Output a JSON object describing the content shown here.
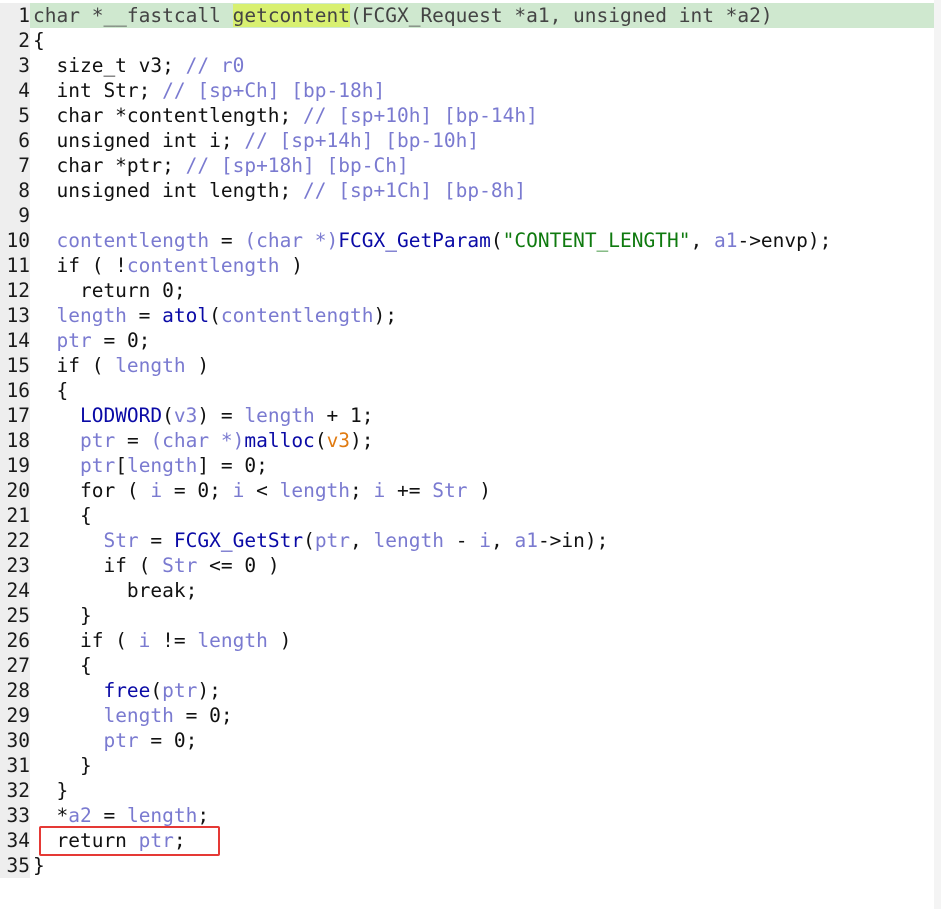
{
  "window": {
    "type": "pseudocode-view",
    "colors": {
      "highlight_line": "#cfe8cf",
      "function_name_highlight": "#d8f070",
      "keyword": "#111111",
      "function_call": "#0a0aa6",
      "variable": "#7a7ad0",
      "string": "#0f7a0f",
      "annotation_box": "#e53935",
      "gutter": "#eeeeee"
    }
  },
  "code": {
    "lines": [
      {
        "n": "1",
        "hl": true,
        "tokens": [
          [
            "sig",
            "char *__fastcall "
          ],
          [
            "hi",
            "getcontent"
          ],
          [
            "sig",
            "(FCGX_Request *a1, unsigned int *a2)"
          ]
        ]
      },
      {
        "n": "2",
        "tokens": [
          [
            "pl",
            "{"
          ]
        ]
      },
      {
        "n": "3",
        "tokens": [
          [
            "pl",
            "  size_t v3; "
          ],
          [
            "cmt",
            "// r0"
          ]
        ]
      },
      {
        "n": "4",
        "tokens": [
          [
            "pl",
            "  int Str; "
          ],
          [
            "cmt",
            "// [sp+Ch] [bp-18h]"
          ]
        ]
      },
      {
        "n": "5",
        "tokens": [
          [
            "pl",
            "  char *contentlength; "
          ],
          [
            "cmt",
            "// [sp+10h] [bp-14h]"
          ]
        ]
      },
      {
        "n": "6",
        "tokens": [
          [
            "pl",
            "  unsigned int i; "
          ],
          [
            "cmt",
            "// [sp+14h] [bp-10h]"
          ]
        ]
      },
      {
        "n": "7",
        "tokens": [
          [
            "pl",
            "  char *ptr; "
          ],
          [
            "cmt",
            "// [sp+18h] [bp-Ch]"
          ]
        ]
      },
      {
        "n": "8",
        "tokens": [
          [
            "pl",
            "  unsigned int length; "
          ],
          [
            "cmt",
            "// [sp+1Ch] [bp-8h]"
          ]
        ]
      },
      {
        "n": "9",
        "tokens": []
      },
      {
        "n": "10",
        "tokens": [
          [
            "pl",
            "  "
          ],
          [
            "var",
            "contentlength"
          ],
          [
            "pl",
            " = "
          ],
          [
            "var",
            "(char *)"
          ],
          [
            "fn",
            "FCGX_GetParam"
          ],
          [
            "pl",
            "("
          ],
          [
            "str",
            "\"CONTENT_LENGTH\""
          ],
          [
            "pl",
            ", "
          ],
          [
            "var",
            "a1"
          ],
          [
            "pl",
            "->envp);"
          ]
        ]
      },
      {
        "n": "11",
        "tokens": [
          [
            "pl",
            "  if ( !"
          ],
          [
            "var",
            "contentlength"
          ],
          [
            "pl",
            " )"
          ]
        ]
      },
      {
        "n": "12",
        "tokens": [
          [
            "pl",
            "    return 0;"
          ]
        ]
      },
      {
        "n": "13",
        "tokens": [
          [
            "pl",
            "  "
          ],
          [
            "var",
            "length"
          ],
          [
            "pl",
            " = "
          ],
          [
            "fn",
            "atol"
          ],
          [
            "pl",
            "("
          ],
          [
            "var",
            "contentlength"
          ],
          [
            "pl",
            ");"
          ]
        ]
      },
      {
        "n": "14",
        "tokens": [
          [
            "pl",
            "  "
          ],
          [
            "var",
            "ptr"
          ],
          [
            "pl",
            " = 0;"
          ]
        ]
      },
      {
        "n": "15",
        "tokens": [
          [
            "pl",
            "  if ( "
          ],
          [
            "var",
            "length"
          ],
          [
            "pl",
            " )"
          ]
        ]
      },
      {
        "n": "16",
        "tokens": [
          [
            "pl",
            "  {"
          ]
        ]
      },
      {
        "n": "17",
        "tokens": [
          [
            "pl",
            "    "
          ],
          [
            "fn",
            "LODWORD"
          ],
          [
            "pl",
            "("
          ],
          [
            "var",
            "v3"
          ],
          [
            "pl",
            ") = "
          ],
          [
            "var",
            "length"
          ],
          [
            "pl",
            " + 1;"
          ]
        ]
      },
      {
        "n": "18",
        "tokens": [
          [
            "pl",
            "    "
          ],
          [
            "var",
            "ptr"
          ],
          [
            "pl",
            " = "
          ],
          [
            "var",
            "(char *)"
          ],
          [
            "fn",
            "malloc"
          ],
          [
            "pl",
            "("
          ],
          [
            "warn",
            "v3"
          ],
          [
            "pl",
            ");"
          ]
        ]
      },
      {
        "n": "19",
        "tokens": [
          [
            "pl",
            "    "
          ],
          [
            "var",
            "ptr"
          ],
          [
            "pl",
            "["
          ],
          [
            "var",
            "length"
          ],
          [
            "pl",
            "] = 0;"
          ]
        ]
      },
      {
        "n": "20",
        "tokens": [
          [
            "pl",
            "    for ( "
          ],
          [
            "var",
            "i"
          ],
          [
            "pl",
            " = 0; "
          ],
          [
            "var",
            "i"
          ],
          [
            "pl",
            " < "
          ],
          [
            "var",
            "length"
          ],
          [
            "pl",
            "; "
          ],
          [
            "var",
            "i"
          ],
          [
            "pl",
            " += "
          ],
          [
            "var",
            "Str"
          ],
          [
            "pl",
            " )"
          ]
        ]
      },
      {
        "n": "21",
        "tokens": [
          [
            "pl",
            "    {"
          ]
        ]
      },
      {
        "n": "22",
        "tokens": [
          [
            "pl",
            "      "
          ],
          [
            "var",
            "Str"
          ],
          [
            "pl",
            " = "
          ],
          [
            "fn",
            "FCGX_GetStr"
          ],
          [
            "pl",
            "("
          ],
          [
            "var",
            "ptr"
          ],
          [
            "pl",
            ", "
          ],
          [
            "var",
            "length"
          ],
          [
            "pl",
            " - "
          ],
          [
            "var",
            "i"
          ],
          [
            "pl",
            ", "
          ],
          [
            "var",
            "a1"
          ],
          [
            "pl",
            "->in);"
          ]
        ]
      },
      {
        "n": "23",
        "tokens": [
          [
            "pl",
            "      if ( "
          ],
          [
            "var",
            "Str"
          ],
          [
            "pl",
            " <= 0 )"
          ]
        ]
      },
      {
        "n": "24",
        "tokens": [
          [
            "pl",
            "        break;"
          ]
        ]
      },
      {
        "n": "25",
        "tokens": [
          [
            "pl",
            "    }"
          ]
        ]
      },
      {
        "n": "26",
        "tokens": [
          [
            "pl",
            "    if ( "
          ],
          [
            "var",
            "i"
          ],
          [
            "pl",
            " != "
          ],
          [
            "var",
            "length"
          ],
          [
            "pl",
            " )"
          ]
        ]
      },
      {
        "n": "27",
        "tokens": [
          [
            "pl",
            "    {"
          ]
        ]
      },
      {
        "n": "28",
        "tokens": [
          [
            "pl",
            "      "
          ],
          [
            "fn",
            "free"
          ],
          [
            "pl",
            "("
          ],
          [
            "var",
            "ptr"
          ],
          [
            "pl",
            ");"
          ]
        ]
      },
      {
        "n": "29",
        "tokens": [
          [
            "pl",
            "      "
          ],
          [
            "var",
            "length"
          ],
          [
            "pl",
            " = 0;"
          ]
        ]
      },
      {
        "n": "30",
        "tokens": [
          [
            "pl",
            "      "
          ],
          [
            "var",
            "ptr"
          ],
          [
            "pl",
            " = 0;"
          ]
        ]
      },
      {
        "n": "31",
        "tokens": [
          [
            "pl",
            "    }"
          ]
        ]
      },
      {
        "n": "32",
        "tokens": [
          [
            "pl",
            "  }"
          ]
        ]
      },
      {
        "n": "33",
        "tokens": [
          [
            "pl",
            "  *"
          ],
          [
            "var",
            "a2"
          ],
          [
            "pl",
            " = "
          ],
          [
            "var",
            "length"
          ],
          [
            "pl",
            ";"
          ]
        ]
      },
      {
        "n": "34",
        "tokens": [
          [
            "pl",
            "  return "
          ],
          [
            "var",
            "ptr"
          ],
          [
            "pl",
            ";"
          ]
        ]
      },
      {
        "n": "35",
        "tokens": [
          [
            "pl",
            "}"
          ]
        ]
      }
    ]
  }
}
